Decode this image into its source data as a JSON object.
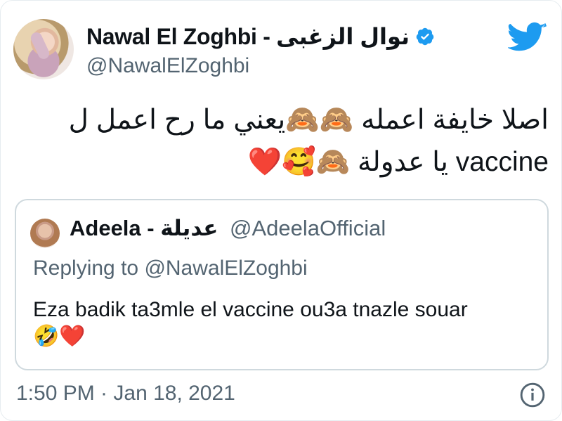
{
  "author": {
    "display_name": "Nawal El Zoghbi - نوال الزغبى",
    "handle": "@NawalElZoghbi",
    "verified_icon": "verified-badge-icon"
  },
  "brand": {
    "logo": "twitter-bird-icon",
    "accent": "#1d9bf0"
  },
  "tweet": {
    "line1": "اصلا خايفة اعمله 🙈🙈يعني ما رح اعمل ل",
    "line2": "vaccine يا عدولة 🙈🥰❤️"
  },
  "quote": {
    "display_name": "Adeela - عديلة",
    "handle": "@AdeelaOfficial",
    "replying_prefix": "Replying to",
    "replying_to": "@NawalElZoghbi",
    "text": "Eza badik ta3mle el vaccine ou3a tnazle souar",
    "emojis": "🤣❤️"
  },
  "footer": {
    "timestamp": "1:50 PM · Jan 18, 2021",
    "info_icon": "info-icon"
  }
}
